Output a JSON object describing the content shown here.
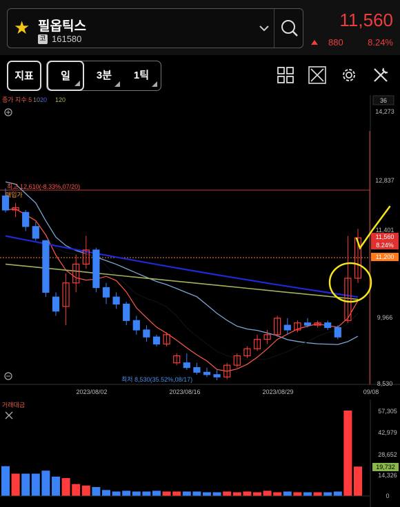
{
  "header": {
    "stock_name": "필옵틱스",
    "market_badge": "코",
    "stock_code": "161580",
    "price": "11,560",
    "change_value": "880",
    "change_pct": "8.24%"
  },
  "toolbar": {
    "indicator_label": "지표",
    "period_day": "일",
    "period_3min": "3분",
    "period_1tick": "1틱",
    "icons": [
      "grid-icon",
      "expand-icon",
      "settings-icon",
      "tools-icon"
    ]
  },
  "chart": {
    "legend_prefix": "종가 지수 5",
    "legend_ma10": "10",
    "legend_ma20": "20",
    "legend_ma120": "120",
    "visible_count": "36",
    "y_ticks": [
      "14,273",
      "12,837",
      "11,401",
      "9,966",
      "8,530"
    ],
    "price_label": "11,560",
    "price_pct_label": "8.24%",
    "avg_price_label": "11,200",
    "avg_price_text": "매입가",
    "high_annotation": "최고 12,610(-8.33%,07/20)",
    "low_annotation": "최저 8,530(35.52%,08/17)",
    "x_ticks": [
      "2023/08/02",
      "2023/08/16",
      "2023/08/29",
      "09/08"
    ],
    "colors": {
      "up": "#ff3b3b",
      "down": "#3b82f6",
      "ma5": "#ff5a4a",
      "ma10": "#000000",
      "ma20": "#7ea6d8",
      "ma60": "#1e2ad8",
      "ma120": "#a3b35a",
      "highlight": "#f5e61a"
    }
  },
  "volume": {
    "label": "거래대금",
    "y_ticks": [
      "57,305",
      "42,979",
      "28,652",
      "19,732",
      "14,326",
      "0"
    ]
  },
  "chart_data": {
    "type": "candlestick",
    "candles_ohlc": [
      [
        12450,
        12610,
        12100,
        12150
      ],
      [
        12150,
        12300,
        12000,
        12200
      ],
      [
        12100,
        12150,
        11700,
        11800
      ],
      [
        11800,
        11900,
        11500,
        11550
      ],
      [
        11500,
        11500,
        10300,
        10400
      ],
      [
        10300,
        10400,
        9900,
        10000
      ],
      [
        10100,
        10800,
        9700,
        10600
      ],
      [
        10600,
        11200,
        10400,
        11000
      ],
      [
        11000,
        11600,
        10900,
        11300
      ],
      [
        11300,
        11350,
        10400,
        10500
      ],
      [
        10500,
        10600,
        10150,
        10300
      ],
      [
        10300,
        10400,
        10050,
        10150
      ],
      [
        10150,
        10200,
        9700,
        9800
      ],
      [
        9800,
        9900,
        9500,
        9600
      ],
      [
        9600,
        9700,
        9350,
        9450
      ],
      [
        9450,
        9500,
        9250,
        9300
      ],
      [
        9300,
        9550,
        9250,
        9500
      ],
      [
        8900,
        9100,
        8850,
        9050
      ],
      [
        8900,
        9100,
        8750,
        8800
      ],
      [
        8800,
        8900,
        8650,
        8700
      ],
      [
        8700,
        8800,
        8600,
        8650
      ],
      [
        8650,
        8750,
        8530,
        8600
      ],
      [
        8600,
        8900,
        8550,
        8850
      ],
      [
        8850,
        9100,
        8800,
        9050
      ],
      [
        9050,
        9250,
        9000,
        9200
      ],
      [
        9200,
        9500,
        9150,
        9400
      ],
      [
        9400,
        9600,
        9300,
        9500
      ],
      [
        9500,
        9900,
        9450,
        9850
      ],
      [
        9700,
        9850,
        9500,
        9600
      ],
      [
        9600,
        9800,
        9550,
        9750
      ],
      [
        9750,
        9850,
        9650,
        9700
      ],
      [
        9700,
        9800,
        9650,
        9750
      ],
      [
        9750,
        9800,
        9600,
        9650
      ],
      [
        9650,
        9700,
        9400,
        9450
      ],
      [
        9800,
        11600,
        9750,
        10700
      ],
      [
        10700,
        11750,
        10600,
        11560
      ]
    ],
    "volume_values": [
      20000,
      15000,
      15000,
      15000,
      17000,
      13000,
      12000,
      8000,
      7000,
      6000,
      4000,
      3000,
      3500,
      3000,
      3000,
      3500,
      3000,
      3000,
      3000,
      3000,
      2500,
      2500,
      3000,
      2500,
      3000,
      2500,
      3500,
      2500,
      3000,
      2500,
      2500,
      2500,
      2500,
      3000,
      57305,
      19732
    ],
    "y_range": [
      8530,
      14273
    ],
    "volume_range": [
      0,
      57305
    ]
  }
}
